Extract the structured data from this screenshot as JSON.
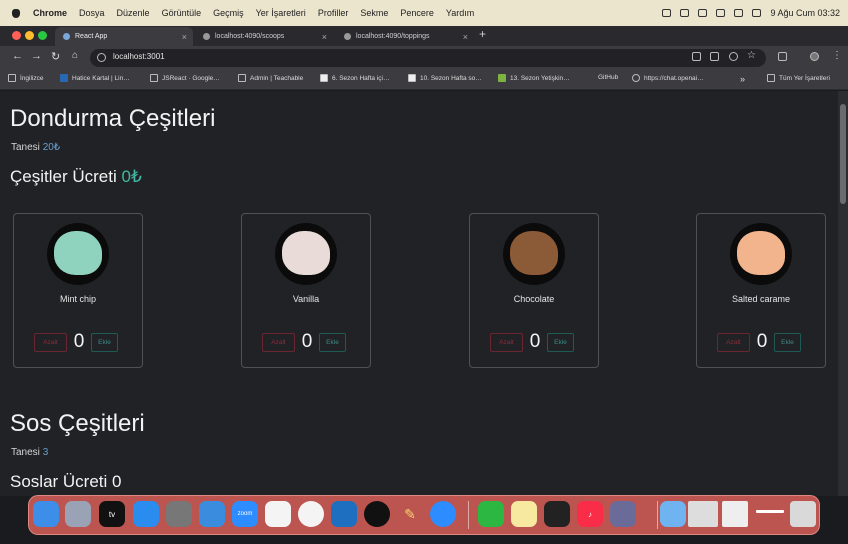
{
  "menubar": {
    "app": "Chrome",
    "items": [
      "Dosya",
      "Düzenle",
      "Görüntüle",
      "Geçmiş",
      "Yer İşaretleri",
      "Profiller",
      "Sekme",
      "Pencere",
      "Yardım"
    ],
    "clock": "9 Ağu Cum  03:32"
  },
  "tabs": [
    {
      "label": "React App",
      "active": true
    },
    {
      "label": "localhost:4090/scoops",
      "active": false
    },
    {
      "label": "localhost:4090/toppings",
      "active": false
    }
  ],
  "omnibox": {
    "url": "localhost:3001"
  },
  "bookmarks": [
    "İngilizce",
    "Hatice Kartal | Lin…",
    "JSReact · Google…",
    "Admin | Teachable",
    "6. Sezon Hafta içi…",
    "10. Sezon Hafta so…",
    "13. Sezon Yetişkin…",
    "GitHub",
    "https://chat.openai…",
    "Tüm Yer İşaretleri"
  ],
  "scoops": {
    "title": "Dondurma Çeşitleri",
    "unit_label": "Tanesi",
    "unit_price": "20₺",
    "total_label": "Çeşitler Ücreti",
    "total_value": "0₺",
    "items": [
      {
        "name": "Mint chip",
        "count": "0",
        "remove": "Azalt",
        "add": "Ekle",
        "color": "#8fd3bf"
      },
      {
        "name": "Vanilla",
        "count": "0",
        "remove": "Azalt",
        "add": "Ekle",
        "color": "#e9dcd8"
      },
      {
        "name": "Chocolate",
        "count": "0",
        "remove": "Azalt",
        "add": "Ekle",
        "color": "#8b5a36"
      },
      {
        "name": "Salted carame",
        "count": "0",
        "remove": "Azalt",
        "add": "Ekle",
        "color": "#f2b48c"
      }
    ]
  },
  "toppings": {
    "title": "Sos Çeşitleri",
    "unit_label": "Tanesi",
    "unit_price": "3",
    "total_label": "Soslar Ücreti 0"
  },
  "dock": {
    "apps": [
      "finder",
      "launchpad",
      "apple-tv",
      "app-store",
      "system-settings",
      "safari",
      "zoom",
      "slack",
      "chrome",
      "vscode",
      "cleaner",
      "pen-tool",
      "zoom-2",
      "whatsapp",
      "notes",
      "terminal",
      "music",
      "color-picker",
      "folder",
      "screenshot",
      "preview",
      "line",
      "trash"
    ]
  }
}
